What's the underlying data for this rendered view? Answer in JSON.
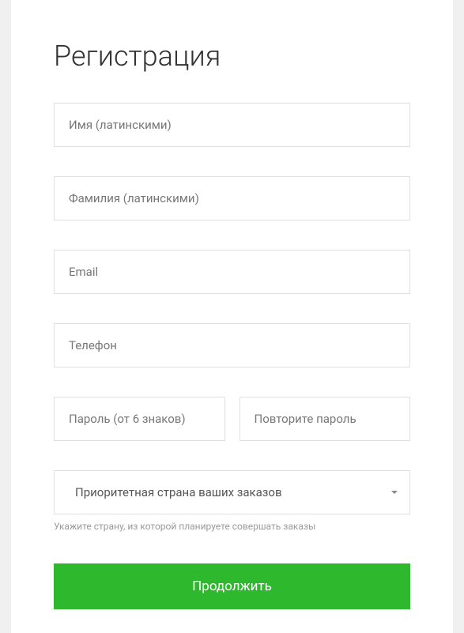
{
  "title": "Регистрация",
  "fields": {
    "firstName": {
      "placeholder": "Имя (латинскими)",
      "value": ""
    },
    "lastName": {
      "placeholder": "Фамилия (латинскими)",
      "value": ""
    },
    "email": {
      "placeholder": "Email",
      "value": ""
    },
    "phone": {
      "placeholder": "Телефон",
      "value": ""
    },
    "password": {
      "placeholder": "Пароль (от 6 знаков)",
      "value": ""
    },
    "passwordRepeat": {
      "placeholder": "Повторите пароль",
      "value": ""
    }
  },
  "countrySelect": {
    "placeholder": "Приоритетная страна ваших заказов",
    "helper": "Укажите страну, из которой планируете совершать заказы"
  },
  "submitLabel": "Продолжить"
}
